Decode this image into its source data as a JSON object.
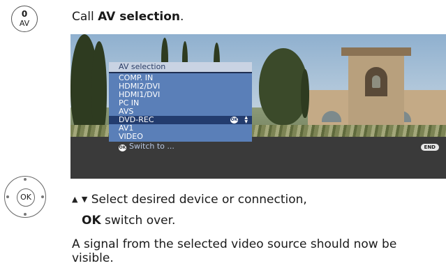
{
  "remote_key": {
    "top": "0",
    "bottom": "AV"
  },
  "step1": {
    "prefix": "Call ",
    "bold": "AV selection",
    "suffix": "."
  },
  "tv_menu": {
    "title": "AV selection",
    "items": [
      "COMP. IN",
      "HDMI2/DVI",
      "HDMI1/DVI",
      "PC IN",
      "AVS",
      "DVD-REC",
      "AV1",
      "VIDEO"
    ],
    "selected": "DVD-REC",
    "ok_icon": "OK",
    "footer": "Switch to ...",
    "end_label": "END"
  },
  "ok_button": {
    "label": "OK"
  },
  "step2": {
    "text": "Select desired device or connection,"
  },
  "step3": {
    "bold": "OK",
    "text": " switch over."
  },
  "step4": {
    "line1": "A signal from the selected video source should now be",
    "line2": "visible."
  },
  "colors": {
    "menu_bg": "#5a7fb8",
    "menu_selected": "#233c6e",
    "menu_title_bg": "#c9d3e3"
  }
}
